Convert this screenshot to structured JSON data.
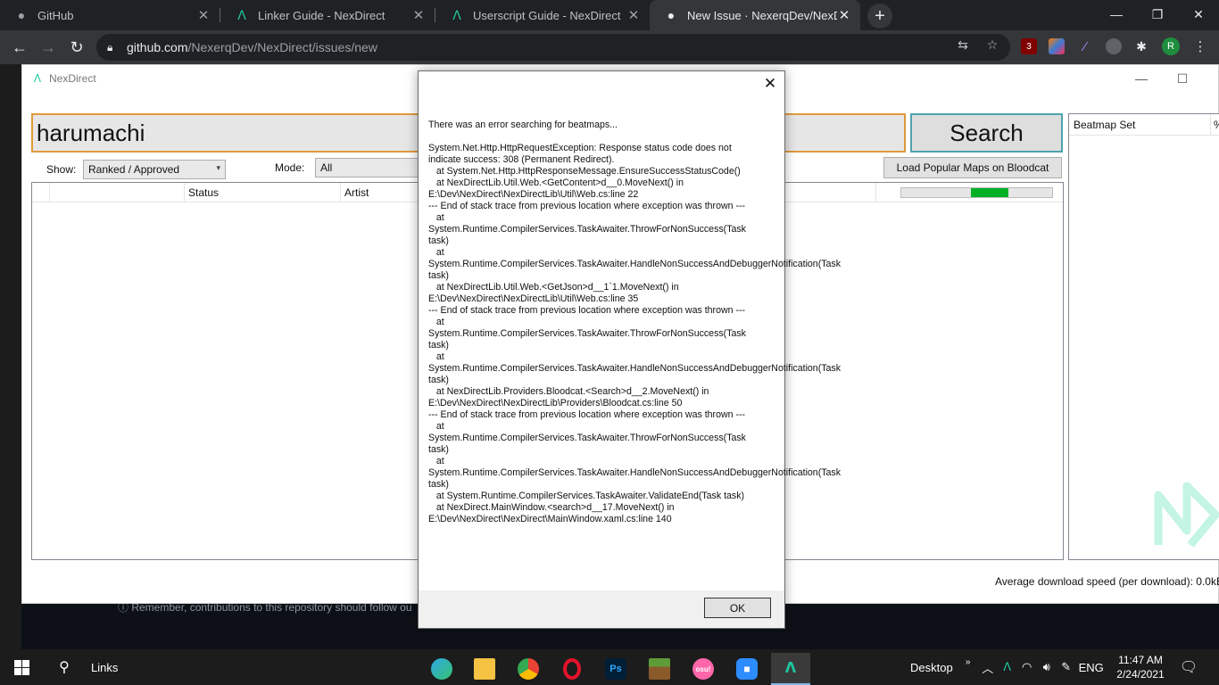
{
  "browser": {
    "tabs": [
      {
        "title": "GitHub",
        "icon": "github-icon"
      },
      {
        "title": "Linker Guide - NexDirect",
        "icon": "nexdirect-icon"
      },
      {
        "title": "Userscript Guide - NexDirect",
        "icon": "nexdirect-icon"
      },
      {
        "title": "New Issue · NexerqDev/NexDirect",
        "icon": "github-icon"
      }
    ],
    "url_host": "github.com",
    "url_path": "/NexerqDev/NexDirect/issues/new",
    "profile_initial": "R",
    "ext_badge": "3"
  },
  "github_note": "Remember, contributions to this repository should follow ou",
  "app": {
    "title": "NexDirect",
    "search_value": "harumachi",
    "search_button": "Search",
    "show_label": "Show:",
    "show_value": "Ranked / Approved",
    "mode_label": "Mode:",
    "mode_value": "All",
    "bloodcat_button": "Load Popular Maps on Bloodcat",
    "columns": [
      "Status",
      "Artist"
    ],
    "progress_fill_start": 0.46,
    "progress_fill_end": 0.71,
    "side_header": "Beatmap Set",
    "side_header2": "%",
    "avg_speed": "Average download speed (per download): 0.0kB"
  },
  "dialog": {
    "message": "There was an error searching for beatmaps...\n\nSystem.Net.Http.HttpRequestException: Response status code does not indicate success: 308 (Permanent Redirect).\n   at System.Net.Http.HttpResponseMessage.EnsureSuccessStatusCode()\n   at NexDirectLib.Util.Web.<GetContent>d__0.MoveNext() in E:\\Dev\\NexDirect\\NexDirectLib\\Util\\Web.cs:line 22\n--- End of stack trace from previous location where exception was thrown ---\n   at System.Runtime.CompilerServices.TaskAwaiter.ThrowForNonSuccess(Task task)\n   at System.Runtime.CompilerServices.TaskAwaiter.HandleNonSuccessAndDebuggerNotification(Task task)\n   at NexDirectLib.Util.Web.<GetJson>d__1`1.MoveNext() in E:\\Dev\\NexDirect\\NexDirectLib\\Util\\Web.cs:line 35\n--- End of stack trace from previous location where exception was thrown ---\n   at System.Runtime.CompilerServices.TaskAwaiter.ThrowForNonSuccess(Task task)\n   at System.Runtime.CompilerServices.TaskAwaiter.HandleNonSuccessAndDebuggerNotification(Task task)\n   at NexDirectLib.Providers.Bloodcat.<Search>d__2.MoveNext() in E:\\Dev\\NexDirect\\NexDirectLib\\Providers\\Bloodcat.cs:line 50\n--- End of stack trace from previous location where exception was thrown ---\n   at System.Runtime.CompilerServices.TaskAwaiter.ThrowForNonSuccess(Task task)\n   at System.Runtime.CompilerServices.TaskAwaiter.HandleNonSuccessAndDebuggerNotification(Task task)\n   at System.Runtime.CompilerServices.TaskAwaiter.ValidateEnd(Task task)\n   at NexDirect.MainWindow.<search>d__17.MoveNext() in E:\\Dev\\NexDirect\\NexDirect\\MainWindow.xaml.cs:line 140",
    "ok_label": "OK"
  },
  "taskbar": {
    "search_label": "Links",
    "desktop_label": "Desktop",
    "language": "ENG",
    "time": "11:47 AM",
    "date": "2/24/2021",
    "apps": [
      "edge-icon",
      "file-explorer-icon",
      "chrome-icon",
      "opera-icon",
      "photoshop-icon",
      "minecraft-icon",
      "osu-icon",
      "zoom-icon",
      "nexdirect-icon"
    ]
  },
  "colors": {
    "search_border": "#e09a3b",
    "search_button_border": "#4fa2ad",
    "progress_green": "#06b025",
    "nexdirect_accent": "#1dc9a0"
  }
}
